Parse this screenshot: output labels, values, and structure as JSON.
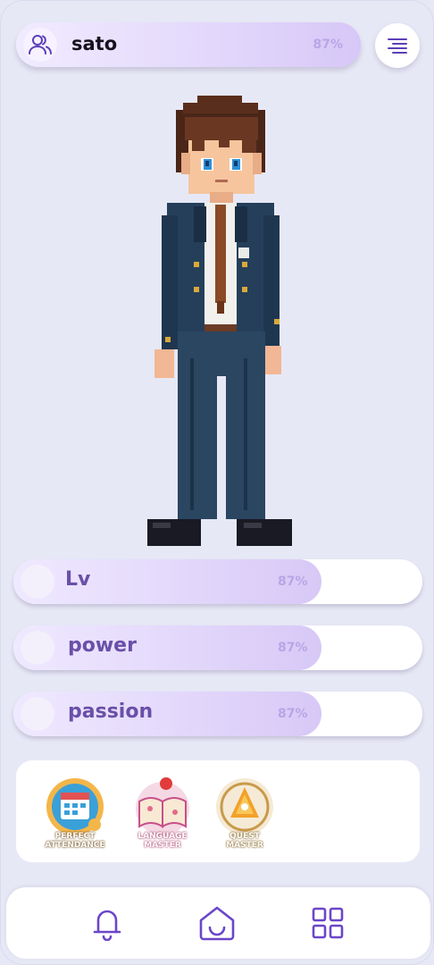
{
  "header": {
    "username": "sato",
    "progress_label": "87%",
    "progress": 0.87
  },
  "icons": {
    "avatar": "users-icon",
    "menu": "hamburger-menu-icon",
    "nav_left": "bell-icon",
    "nav_center": "home-icon",
    "nav_right": "grid-icon"
  },
  "stats": [
    {
      "label": "Lv",
      "value_label": "87%",
      "value": 0.87
    },
    {
      "label": "power",
      "value_label": "87%",
      "value": 0.87
    },
    {
      "label": "passion",
      "value_label": "87%",
      "value": 0.87
    }
  ],
  "badges": [
    {
      "name": "perfect-attendance",
      "caption_lines": [
        "PERFECT",
        "ATTENDANCE"
      ]
    },
    {
      "name": "language-master",
      "caption_lines": [
        "LANGUAGE",
        "MASTER"
      ]
    },
    {
      "name": "quest-master",
      "caption_lines": [
        "QUEST",
        "MASTER"
      ]
    }
  ],
  "colors": {
    "accent": "#6b46c9",
    "background": "#e7e8f6",
    "progress_text": "#b7a6e6"
  }
}
